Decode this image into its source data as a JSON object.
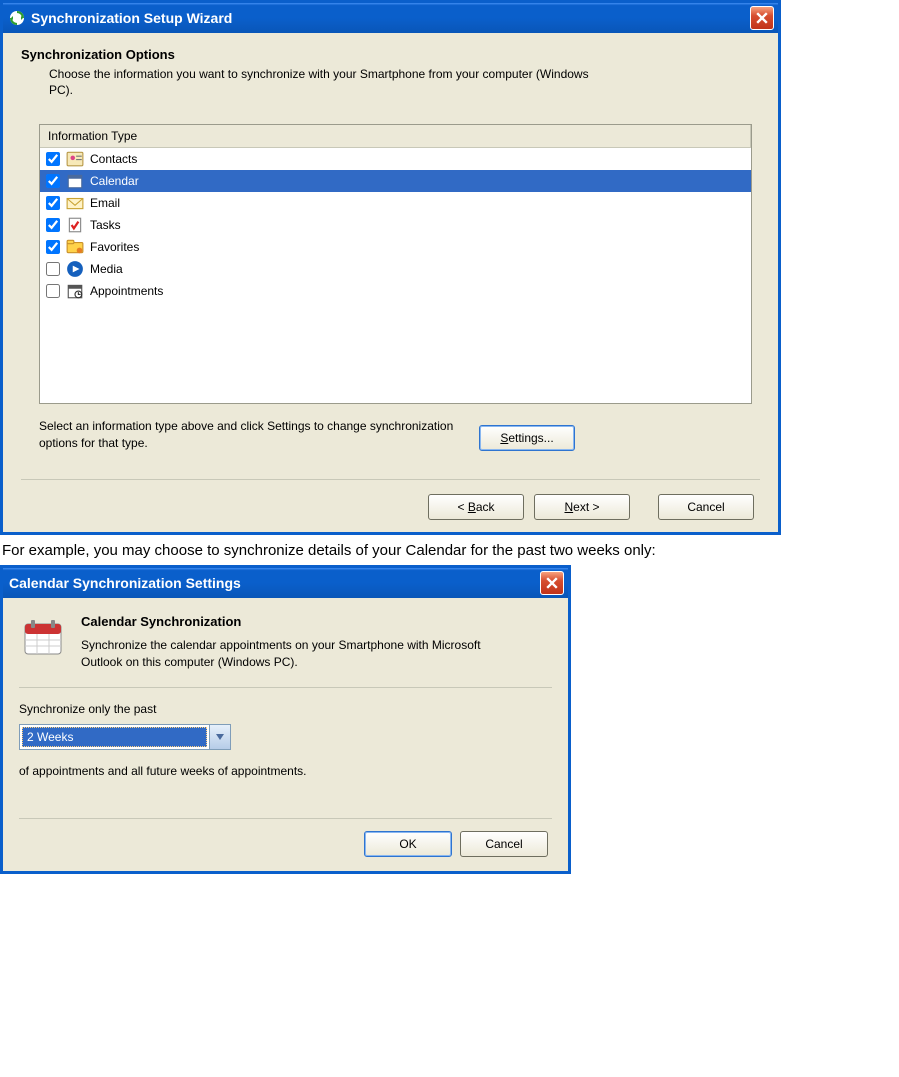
{
  "wizard": {
    "title": "Synchronization Setup Wizard",
    "heading": "Synchronization Options",
    "subheading": "Choose the information you want to synchronize with your Smartphone from your computer (Windows PC).",
    "list_header": "Information Type",
    "items": [
      {
        "label": "Contacts",
        "checked": true,
        "selected": false,
        "icon": "contacts-icon"
      },
      {
        "label": "Calendar",
        "checked": true,
        "selected": true,
        "icon": "calendar-icon"
      },
      {
        "label": "Email",
        "checked": true,
        "selected": false,
        "icon": "email-icon"
      },
      {
        "label": "Tasks",
        "checked": true,
        "selected": false,
        "icon": "tasks-icon"
      },
      {
        "label": "Favorites",
        "checked": true,
        "selected": false,
        "icon": "favorites-icon"
      },
      {
        "label": "Media",
        "checked": false,
        "selected": false,
        "icon": "media-icon"
      },
      {
        "label": "Appointments",
        "checked": false,
        "selected": false,
        "icon": "appointments-icon"
      }
    ],
    "hint": "Select an information type above and click Settings to change synchronization options for that type.",
    "settings_button": "Settings...",
    "back_button": "< Back",
    "next_button": "Next >",
    "cancel_button": "Cancel"
  },
  "doc_paragraph": "For example, you may choose to synchronize details of your Calendar for the past two weeks only:",
  "calendar_dialog": {
    "title": "Calendar Synchronization Settings",
    "heading": "Calendar Synchronization",
    "description": "Synchronize the calendar appointments on your Smartphone with Microsoft Outlook on this computer (Windows PC).",
    "past_label": "Synchronize only the past",
    "select_value": "2 Weeks",
    "after_select": "of appointments and all future weeks of appointments.",
    "ok_button": "OK",
    "cancel_button": "Cancel"
  }
}
